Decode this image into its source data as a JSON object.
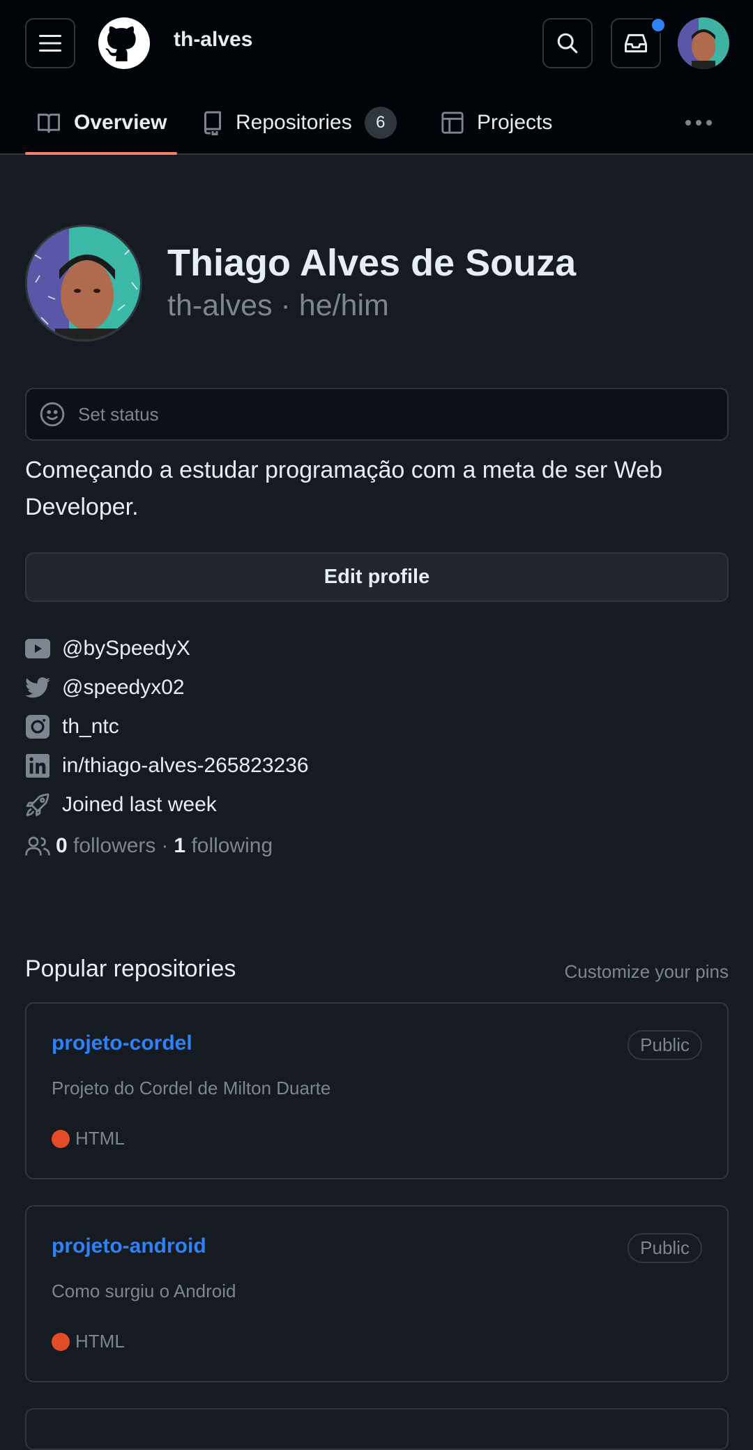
{
  "header": {
    "username": "th-alves",
    "notification_color": "#2f81f7"
  },
  "tabs": [
    {
      "label": "Overview",
      "icon": "book-icon",
      "selected": true
    },
    {
      "label": "Repositories",
      "icon": "repo-icon",
      "count": "6"
    },
    {
      "label": "Projects",
      "icon": "table-icon"
    }
  ],
  "profile": {
    "full_name": "Thiago Alves de Souza",
    "login_line": "th-alves · he/him",
    "status_placeholder": "Set status",
    "bio": "Começando a estudar programação com a meta de ser Web Developer.",
    "edit_button": "Edit profile",
    "links": [
      {
        "icon": "youtube-icon",
        "text": "@bySpeedyX"
      },
      {
        "icon": "twitter-icon",
        "text": "@speedyx02"
      },
      {
        "icon": "instagram-icon",
        "text": "th_ntc"
      },
      {
        "icon": "linkedin-icon",
        "text": "in/thiago-alves-265823236"
      },
      {
        "icon": "rocket-icon",
        "text": "Joined last week"
      }
    ],
    "followers_count": "0",
    "followers_label": "followers",
    "separator": "·",
    "following_count": "1",
    "following_label": "following"
  },
  "popular": {
    "title": "Popular repositories",
    "customize": "Customize your pins",
    "repos": [
      {
        "name": "projeto-cordel",
        "visibility": "Public",
        "description": "Projeto do Cordel de Milton Duarte",
        "language": "HTML",
        "language_color": "#e34c26"
      },
      {
        "name": "projeto-android",
        "visibility": "Public",
        "description": "Como surgiu o Android",
        "language": "HTML",
        "language_color": "#e34c26"
      }
    ]
  },
  "colors": {
    "accent": "#f78166",
    "link": "#2f81f7",
    "background": "#161b22",
    "header": "#010409"
  }
}
